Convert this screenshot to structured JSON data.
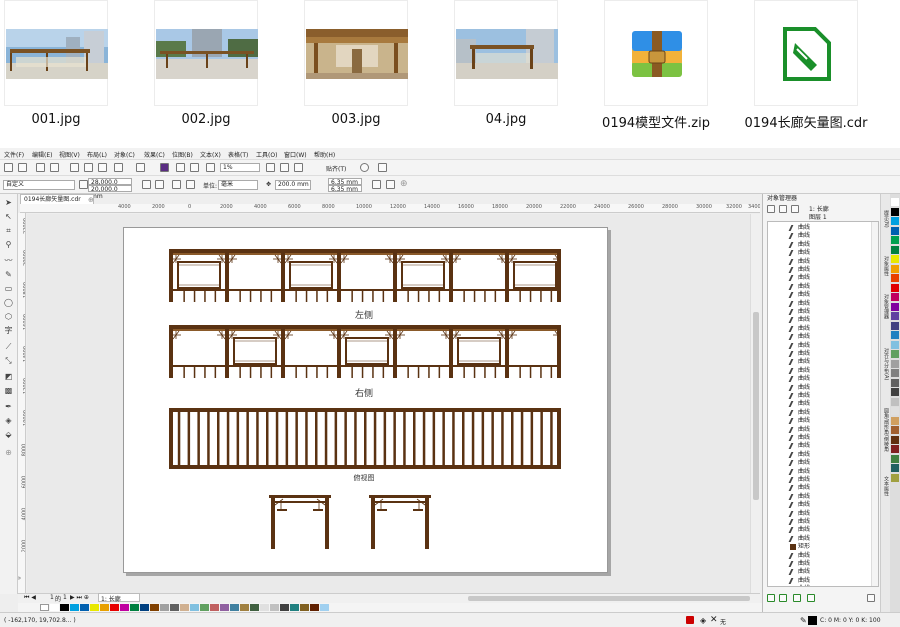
{
  "thumbnails": [
    {
      "filename": "001.jpg",
      "icon": "photo-thumbnail"
    },
    {
      "filename": "002.jpg",
      "icon": "photo-thumbnail"
    },
    {
      "filename": "003.jpg",
      "icon": "photo-thumbnail"
    },
    {
      "filename": "04.jpg",
      "icon": "photo-thumbnail"
    },
    {
      "filename": "0194模型文件.zip",
      "icon": "zip-archive-icon"
    },
    {
      "filename": "0194长廊矢量图.cdr",
      "icon": "cdr-file-icon"
    }
  ],
  "menubar": [
    "文件(F)",
    "编辑(E)",
    "视图(V)",
    "布局(L)",
    "对象(C)",
    "效果(C)",
    "位图(B)",
    "文本(X)",
    "表格(T)",
    "工具(O)",
    "窗口(W)",
    "帮助(H)"
  ],
  "toolbar": {
    "zoom": "1%",
    "snap_label": "贴齐(T)"
  },
  "propbar": {
    "preset": "自定义",
    "width": "28,000.0 mm",
    "height": "20,000.0 mm",
    "units_label": "单位:",
    "units": "毫米",
    "nudge": "200.0 mm",
    "dup_x": "6.35 mm",
    "dup_y": "6.35 mm"
  },
  "document_tab": "0194长廊矢量图.cdr",
  "hruler_ticks": [
    "4000",
    "2000",
    "0",
    "2000",
    "4000",
    "6000",
    "8000",
    "10000",
    "12000",
    "14000",
    "16000",
    "18000",
    "20000",
    "22000",
    "24000",
    "26000",
    "28000",
    "30000",
    "32000",
    "34000"
  ],
  "vruler_ticks": [
    "22000",
    "20000",
    "18000",
    "16000",
    "14000",
    "12000",
    "10000",
    "8000",
    "6000",
    "4000",
    "2000",
    "0"
  ],
  "drawing": {
    "left_side_caption": "左侧",
    "right_side_caption": "右侧",
    "top_view_caption": "俯视图"
  },
  "pagenav": {
    "current": "1",
    "of_label": "的",
    "total": "1",
    "page_tab": "1: 长廊"
  },
  "docker": {
    "title": "对象管理器",
    "page_label": "1: 长廊",
    "layer_label": "图层 1",
    "items": [
      "曲线",
      "曲线",
      "曲线",
      "曲线",
      "曲线",
      "曲线",
      "曲线",
      "曲线",
      "曲线",
      "曲线",
      "曲线",
      "曲线",
      "曲线",
      "曲线",
      "曲线",
      "曲线",
      "曲线",
      "曲线",
      "曲线",
      "曲线",
      "曲线",
      "曲线",
      "曲线",
      "曲线",
      "曲线",
      "曲线",
      "曲线",
      "曲线",
      "曲线",
      "曲线",
      "曲线",
      "曲线",
      "曲线",
      "曲线",
      "曲线",
      "曲线",
      "曲线",
      "曲线",
      "矩形",
      "曲线",
      "曲线",
      "曲线",
      "曲线",
      "曲线",
      "曲线"
    ],
    "side_tabs": [
      "提示(N)",
      "对象属性",
      "对象管理器",
      "对齐与分布(A)",
      "圆角/扇形角/倒棱角",
      "文本属性"
    ]
  },
  "status": {
    "coords": "( -162,170, 19,702.8... )",
    "fill_none": "无",
    "color_info": "C: 0 M: 0 Y: 0 K: 100"
  },
  "palette_colors": [
    "#ffffff",
    "#000000",
    "#00a0e0",
    "#0060b0",
    "#e8e800",
    "#e8a000",
    "#e80000",
    "#c000a0",
    "#008040",
    "#004080",
    "#804000",
    "#a0a0a0",
    "#606060",
    "#d0b090",
    "#80c0e0",
    "#60a060",
    "#c06060",
    "#9060a0",
    "#4080a0",
    "#a08040",
    "#406040",
    "#e0e0e0",
    "#c0c0c0",
    "#404040",
    "#208080",
    "#806020",
    "#602000",
    "#a0d0f0"
  ],
  "right_palette": [
    "#ffffff",
    "#000000",
    "#00a0e0",
    "#0060b0",
    "#00a050",
    "#008040",
    "#e8e800",
    "#f0a000",
    "#e84000",
    "#e00000",
    "#c00060",
    "#8000a0",
    "#6040a0",
    "#404080",
    "#2080c0",
    "#80c0e0",
    "#60a060",
    "#a0a0a0",
    "#808080",
    "#606060",
    "#404040",
    "#c0c0c0",
    "#e0e0e0",
    "#d0a060",
    "#a06030",
    "#603010",
    "#802020",
    "#408040",
    "#206060",
    "#a0a040"
  ],
  "colors": {
    "timber": "#5a3212",
    "accent": "#1d6fc9"
  }
}
